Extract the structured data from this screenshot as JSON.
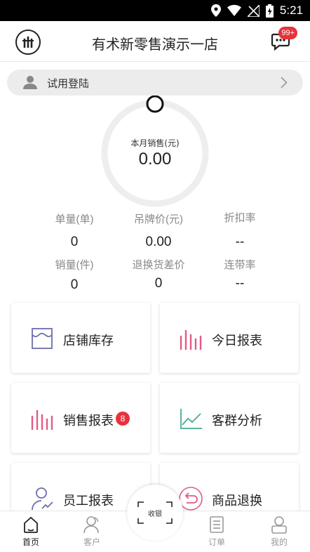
{
  "status_bar": {
    "time": "5:21",
    "icons": [
      "location-icon",
      "wifi-icon",
      "no-sim-icon",
      "battery-charging-icon"
    ]
  },
  "header": {
    "logo_icon": "brand-logo-icon",
    "title": "有术新零售演示一店",
    "message_icon": "message-bubble-icon",
    "message_badge": "99+"
  },
  "login": {
    "avatar_icon": "user-avatar-icon",
    "label": "试用登陆",
    "arrow_icon": "chevron-right-icon"
  },
  "sales": {
    "label": "本月销售(元)",
    "value": "0.00",
    "progress": 0
  },
  "stats": [
    {
      "label": "单量(单)",
      "value": "0"
    },
    {
      "label": "吊牌价(元)",
      "value": "0.00"
    },
    {
      "label": "折扣率",
      "value": "--"
    },
    {
      "label": "销量(件)",
      "value": "0"
    },
    {
      "label": "退换货差价",
      "value": "0"
    },
    {
      "label": "连带率",
      "value": "--"
    }
  ],
  "cards": [
    {
      "label": "店铺库存",
      "icon": "inventory-box-icon"
    },
    {
      "label": "今日报表",
      "icon": "bar-chart-icon"
    },
    {
      "label": "销售报表",
      "icon": "bar-chart-icon",
      "badge": "8"
    },
    {
      "label": "客群分析",
      "icon": "line-chart-icon"
    },
    {
      "label": "员工报表",
      "icon": "employee-icon"
    },
    {
      "label": "商品退换",
      "icon": "return-icon"
    }
  ],
  "nav": {
    "items": [
      {
        "label": "首页",
        "icon": "home-icon",
        "active": true
      },
      {
        "label": "客户",
        "icon": "customer-icon",
        "active": false
      },
      {
        "label": "订单",
        "icon": "order-icon",
        "active": false
      },
      {
        "label": "我的",
        "icon": "profile-icon",
        "active": false
      }
    ],
    "scan_label": "收银"
  },
  "colors": {
    "accent_red": "#e8323b",
    "icon_purple": "#6d6dab",
    "icon_pink": "#e25b84",
    "icon_green": "#4aab92",
    "ring_gray": "#eeeeee"
  }
}
